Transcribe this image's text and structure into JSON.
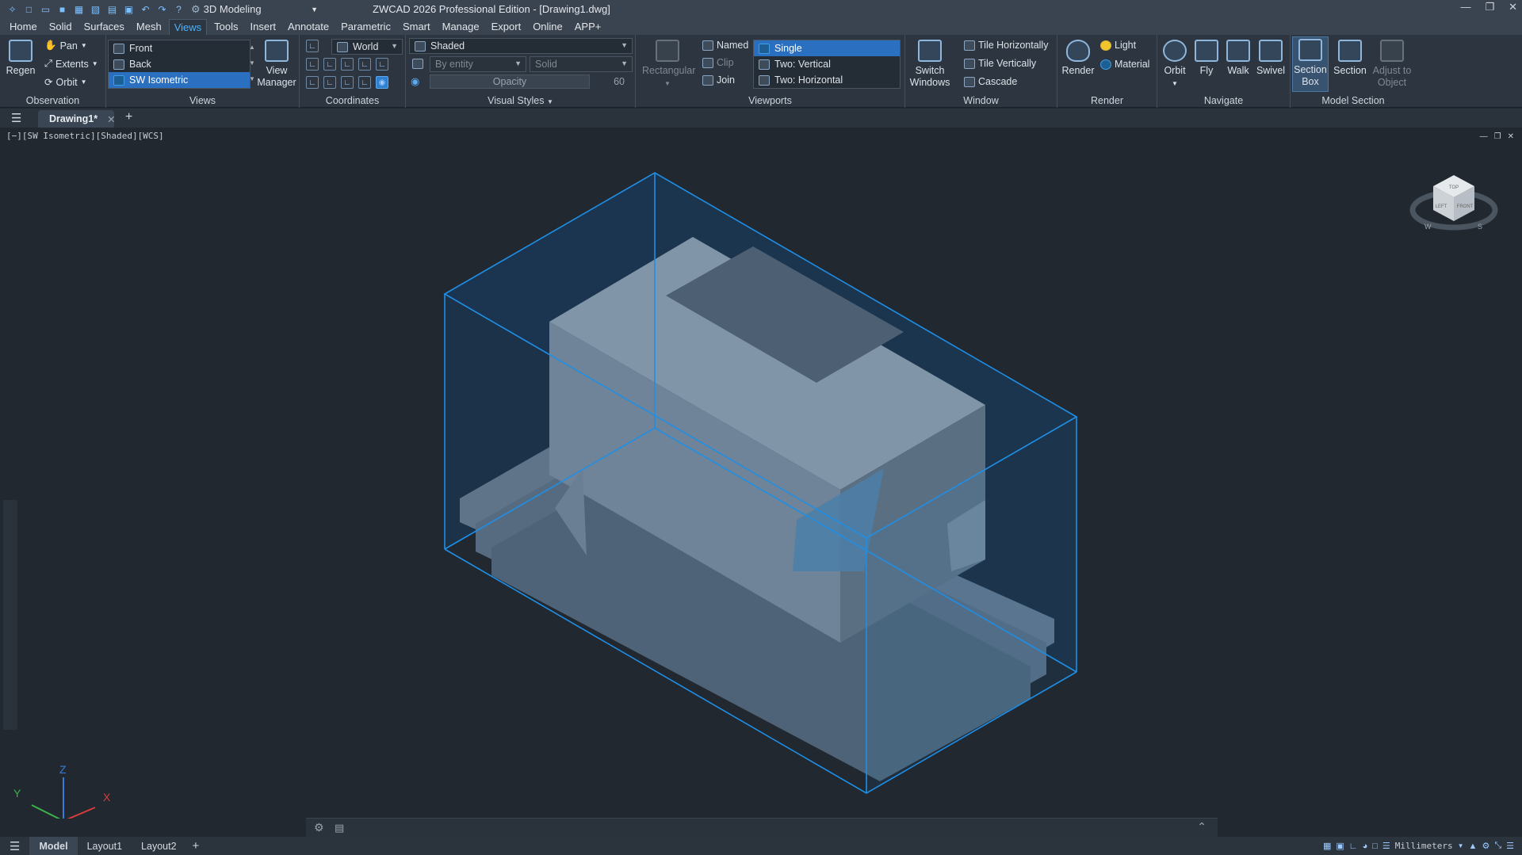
{
  "app": {
    "title": "ZWCAD 2026 Professional Edition - [Drawing1.dwg]",
    "workspace": "3D Modeling"
  },
  "menu": [
    "Home",
    "Solid",
    "Surfaces",
    "Mesh",
    "Views",
    "Tools",
    "Insert",
    "Annotate",
    "Parametric",
    "Smart",
    "Manage",
    "Export",
    "Online",
    "APP+"
  ],
  "active_menu": "Views",
  "observation": {
    "title": "Observation",
    "regen": "Regen",
    "pan": "Pan",
    "extents": "Extents",
    "orbit": "Orbit"
  },
  "views": {
    "title": "Views",
    "items": [
      "Front",
      "Back",
      "SW Isometric"
    ],
    "selected": "SW Isometric",
    "manager": "View Manager"
  },
  "coordinates": {
    "title": "Coordinates",
    "ucs": "World"
  },
  "visual_styles": {
    "title": "Visual Styles",
    "style": "Shaded",
    "color": "By entity",
    "face": "Solid",
    "opacity_label": "Opacity",
    "opacity_value": "60"
  },
  "viewports": {
    "title": "Viewports",
    "rectangular": "Rectangular",
    "named": "Named",
    "clip": "Clip",
    "join": "Join",
    "configs": [
      "Single",
      "Two:  Vertical",
      "Two:  Horizontal"
    ],
    "selected": "Single"
  },
  "window": {
    "title": "Window",
    "switch": "Switch Windows",
    "tile_h": "Tile Horizontally",
    "tile_v": "Tile Vertically",
    "cascade": "Cascade"
  },
  "render": {
    "title": "Render",
    "render": "Render",
    "light": "Light",
    "material": "Material"
  },
  "navigate": {
    "title": "Navigate",
    "orbit": "Orbit",
    "fly": "Fly",
    "walk": "Walk",
    "swivel": "Swivel"
  },
  "model_section": {
    "title": "Model Section",
    "section_box": "Section Box",
    "section": "Section",
    "adjust": "Adjust to Object"
  },
  "tabs": {
    "drawing": "Drawing1*"
  },
  "viewport_label": "[−][SW Isometric][Shaded][WCS]",
  "viewcube": {
    "top": "TOP",
    "left": "LEFT",
    "front": "FRONT",
    "w": "W",
    "s": "S"
  },
  "axes": {
    "x": "X",
    "y": "Y",
    "z": "Z"
  },
  "layouts": [
    "Model",
    "Layout1",
    "Layout2"
  ],
  "units": "Millimeters",
  "colors": {
    "accent": "#2a6fc0",
    "section_box": "#1f8fe6"
  }
}
